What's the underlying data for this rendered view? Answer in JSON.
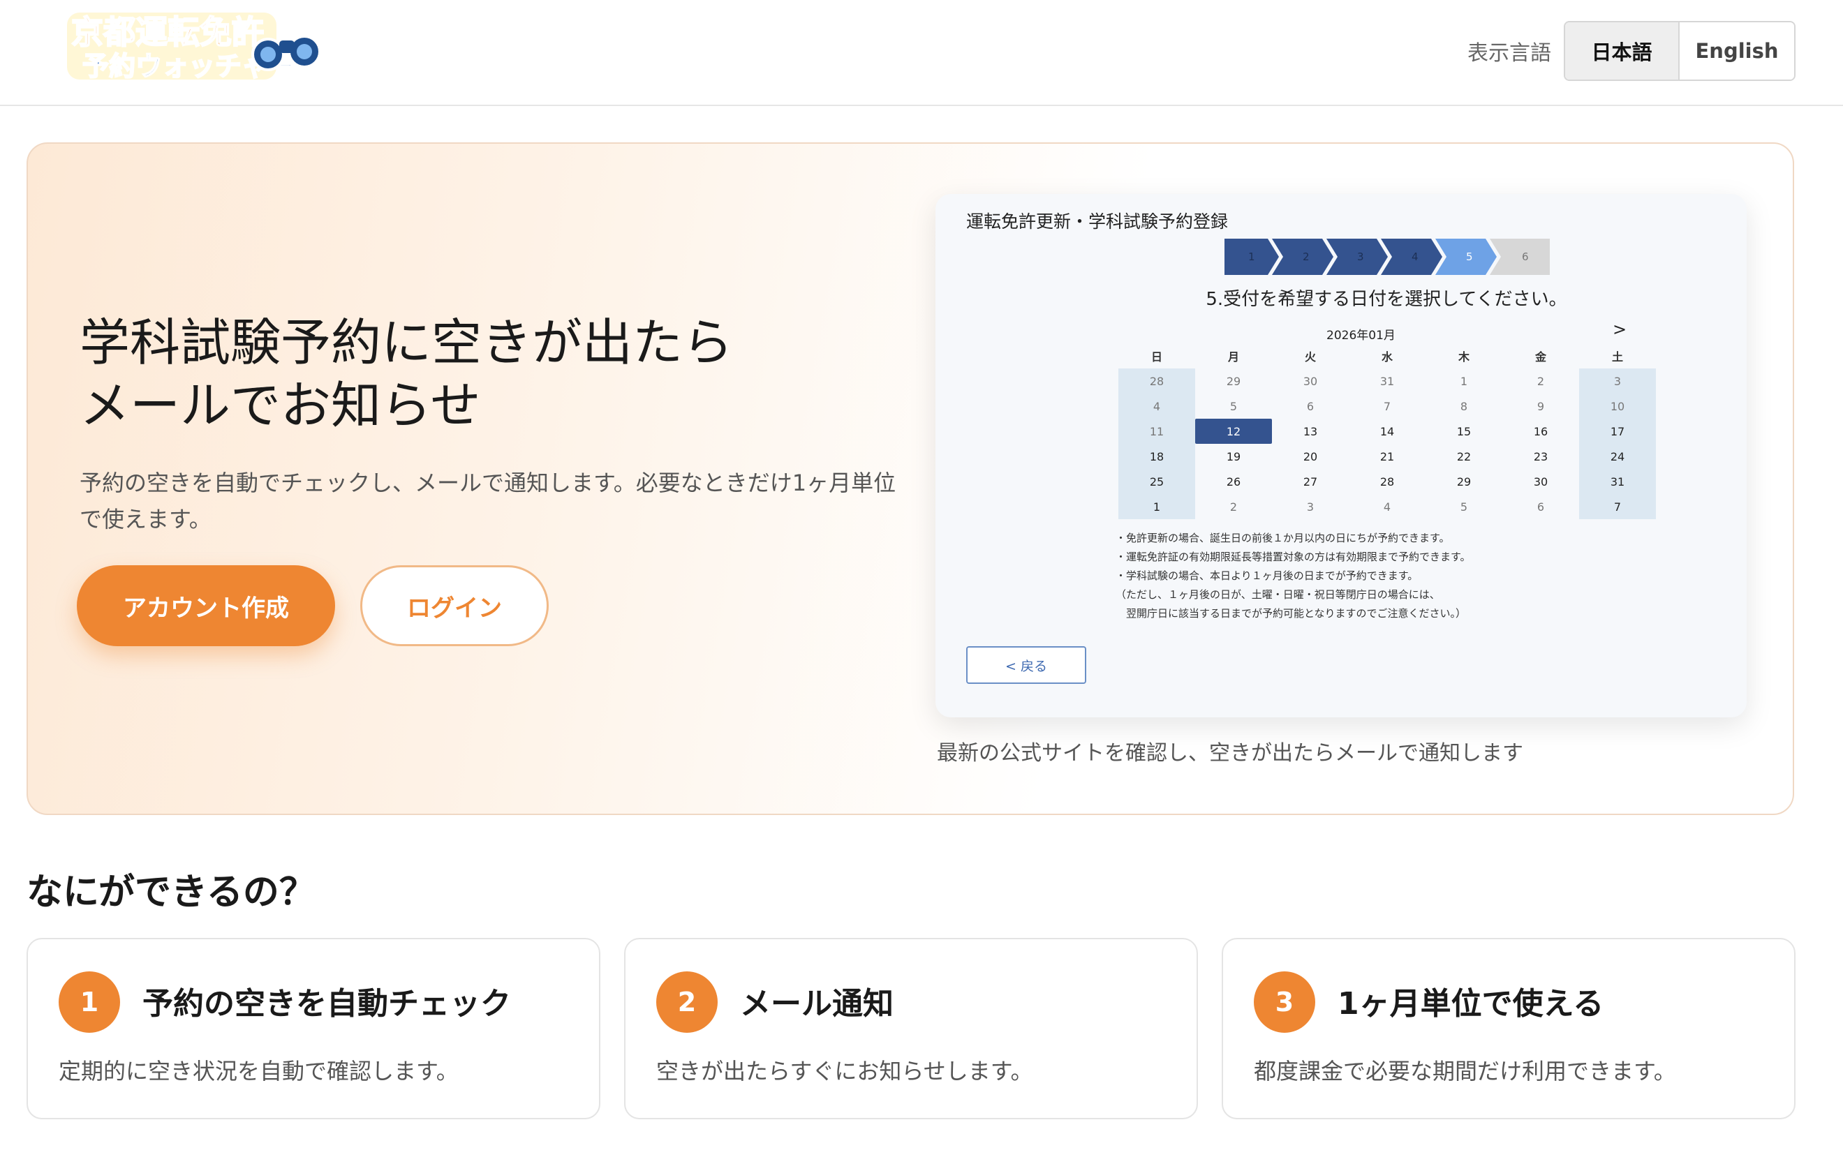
{
  "header": {
    "logo_text_line1": "京都運転免許",
    "logo_text_line2": "予約ウォッチャー",
    "language_label": "表示言語",
    "lang_ja": "日本語",
    "lang_en": "English"
  },
  "hero": {
    "title_line1": "学科試験予約に空きが出たら",
    "title_line2": "メールでお知らせ",
    "subtitle": "予約の空きを自動でチェックし、メールで通知します。必要なときだけ1ヶ月単位で使えます。",
    "primary_button": "アカウント作成",
    "secondary_button": "ログイン",
    "caption": "最新の公式サイトを確認し、空きが出たらメールで通知します"
  },
  "mockup": {
    "title": "運転免許更新・学科試験予約登録",
    "steps": [
      "1",
      "2",
      "3",
      "4",
      "5",
      "6"
    ],
    "active_step": 5,
    "instruction": "5.受付を希望する日付を選択してください。",
    "month": "2026年01月",
    "next": ">",
    "weekdays": [
      "日",
      "月",
      "火",
      "水",
      "木",
      "金",
      "土"
    ],
    "weeks": [
      [
        "28",
        "29",
        "30",
        "31",
        "1",
        "2",
        "3"
      ],
      [
        "4",
        "5",
        "6",
        "7",
        "8",
        "9",
        "10"
      ],
      [
        "11",
        "12",
        "13",
        "14",
        "15",
        "16",
        "17"
      ],
      [
        "18",
        "19",
        "20",
        "21",
        "22",
        "23",
        "24"
      ],
      [
        "25",
        "26",
        "27",
        "28",
        "29",
        "30",
        "31"
      ],
      [
        "1",
        "2",
        "3",
        "4",
        "5",
        "6",
        "7"
      ]
    ],
    "selected": "12",
    "notes": [
      "・免許更新の場合、誕生日の前後１か月以内の日にちが予約できます。",
      "・運転免許証の有効期限延長等措置対象の方は有効期限まで予約できます。",
      "・学科試験の場合、本日より１ヶ月後の日までが予約できます。",
      "（ただし、１ヶ月後の日が、土曜・日曜・祝日等閉庁日の場合には、",
      "　翌開庁日に該当する日までが予約可能となりますのでご注意ください。）"
    ],
    "back_button": "< 戻る"
  },
  "features": {
    "heading": "なにができるの？",
    "items": [
      {
        "num": "1",
        "title": "予約の空きを自動チェック",
        "desc": "定期的に空き状況を自動で確認します。"
      },
      {
        "num": "2",
        "title": "メール通知",
        "desc": "空きが出たらすぐにお知らせします。"
      },
      {
        "num": "3",
        "title": "1ヶ月単位で使える",
        "desc": "都度課金で必要な期間だけ利用できます。"
      }
    ]
  },
  "colors": {
    "accent": "#ee8632",
    "step_done": "#34538f",
    "step_active": "#6ea2e6",
    "calendar_weekend": "#dce8f2"
  }
}
